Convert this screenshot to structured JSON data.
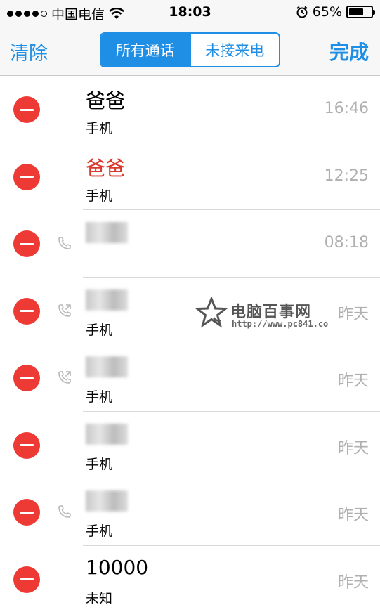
{
  "status_bar": {
    "carrier": "中国电信",
    "time": "18:03",
    "battery_percent": "65%",
    "battery_level": 0.65,
    "signal_dots_filled": 4,
    "signal_dots_total": 5
  },
  "nav": {
    "clear_label": "清除",
    "done_label": "完成",
    "segments": [
      {
        "label": "所有通话",
        "active": true
      },
      {
        "label": "未接来电",
        "active": false
      }
    ]
  },
  "calls": [
    {
      "name": "爸爸",
      "type": "手机",
      "time": "16:46",
      "missed": false,
      "blurred": false,
      "icon": ""
    },
    {
      "name": "爸爸",
      "type": "手机",
      "time": "12:25",
      "missed": true,
      "blurred": false,
      "icon": ""
    },
    {
      "name": "",
      "type": "",
      "time": "08:18",
      "missed": false,
      "blurred": true,
      "icon": "phone-icon"
    },
    {
      "name": "",
      "type": "手机",
      "time": "昨天",
      "missed": false,
      "blurred": true,
      "icon": "outgoing-call-icon"
    },
    {
      "name": "",
      "type": "手机",
      "time": "昨天",
      "missed": false,
      "blurred": true,
      "icon": "outgoing-call-icon"
    },
    {
      "name": "",
      "type": "手机",
      "time": "昨天",
      "missed": false,
      "blurred": true,
      "icon": ""
    },
    {
      "name": "",
      "type": "手机",
      "time": "昨天",
      "missed": false,
      "blurred": true,
      "icon": "phone-icon"
    },
    {
      "name": "10000",
      "type": "未知",
      "time": "昨天",
      "missed": false,
      "blurred": false,
      "icon": ""
    }
  ],
  "watermark": {
    "title": "电脑百事网",
    "url": "http://www.pc841.co"
  },
  "colors": {
    "accent": "#1f8ee5",
    "delete_red": "#ee3a35",
    "missed_red": "#d9392c",
    "time_gray": "#b0b0b0"
  }
}
